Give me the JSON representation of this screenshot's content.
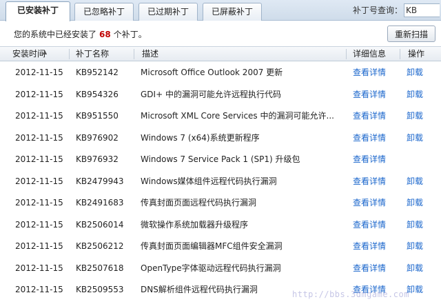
{
  "tabs": [
    {
      "label": "已安装补丁",
      "active": true
    },
    {
      "label": "已忽略补丁",
      "active": false
    },
    {
      "label": "已过期补丁",
      "active": false
    },
    {
      "label": "已屏蔽补丁",
      "active": false
    }
  ],
  "search": {
    "label": "补丁号查询：",
    "value": "KB"
  },
  "info": {
    "prefix": "您的系统中已经安装了",
    "count": "68",
    "suffix": "个补丁。"
  },
  "rescan_label": "重新扫描",
  "columns": {
    "install_time": "安装时间",
    "patch_name": "补丁名称",
    "description": "描述",
    "detail": "详细信息",
    "action": "操作"
  },
  "rows": [
    {
      "date": "2012-11-15",
      "kb": "KB952142",
      "desc": "Microsoft Office Outlook 2007 更新",
      "detail": "查看详情",
      "uninstall": "卸载"
    },
    {
      "date": "2012-11-15",
      "kb": "KB954326",
      "desc": "GDI+ 中的漏洞可能允许远程执行代码",
      "detail": "查看详情",
      "uninstall": "卸载"
    },
    {
      "date": "2012-11-15",
      "kb": "KB951550",
      "desc": "Microsoft XML Core Services 中的漏洞可能允许...",
      "detail": "查看详情",
      "uninstall": "卸载"
    },
    {
      "date": "2012-11-15",
      "kb": "KB976902",
      "desc": "Windows 7 (x64)系统更新程序",
      "detail": "查看详情",
      "uninstall": "卸载"
    },
    {
      "date": "2012-11-15",
      "kb": "KB976932",
      "desc": "Windows 7 Service Pack 1 (SP1) 升级包",
      "detail": "查看详情",
      "uninstall": ""
    },
    {
      "date": "2012-11-15",
      "kb": "KB2479943",
      "desc": "Windows媒体组件远程代码执行漏洞",
      "detail": "查看详情",
      "uninstall": "卸载"
    },
    {
      "date": "2012-11-15",
      "kb": "KB2491683",
      "desc": "传真封面页面远程代码执行漏洞",
      "detail": "查看详情",
      "uninstall": "卸载"
    },
    {
      "date": "2012-11-15",
      "kb": "KB2506014",
      "desc": "微软操作系统加载器升级程序",
      "detail": "查看详情",
      "uninstall": "卸载"
    },
    {
      "date": "2012-11-15",
      "kb": "KB2506212",
      "desc": "传真封面页面编辑器MFC组件安全漏洞",
      "detail": "查看详情",
      "uninstall": "卸载"
    },
    {
      "date": "2012-11-15",
      "kb": "KB2507618",
      "desc": "OpenType字体驱动远程代码执行漏洞",
      "detail": "查看详情",
      "uninstall": "卸载"
    },
    {
      "date": "2012-11-15",
      "kb": "KB2509553",
      "desc": "DNS解析组件远程代码执行漏洞",
      "detail": "查看详情",
      "uninstall": "卸载"
    }
  ],
  "watermark": "http://bbs.3dmgame.com"
}
